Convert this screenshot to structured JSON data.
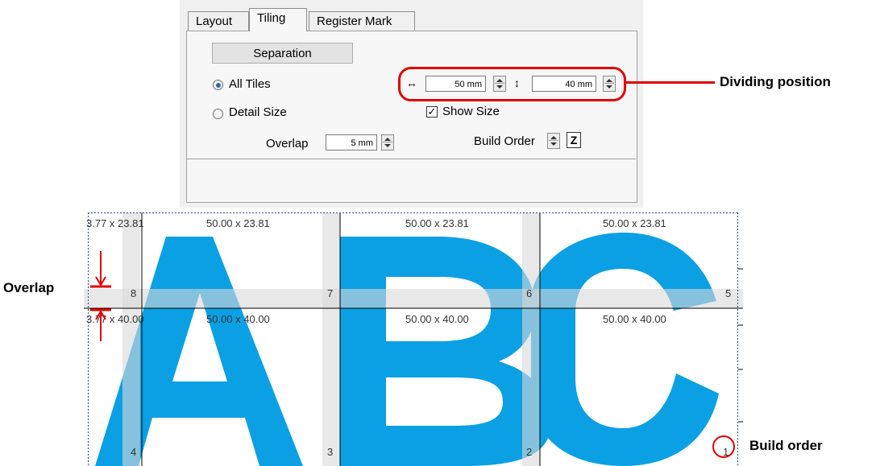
{
  "dialog": {
    "tabs": [
      {
        "label": "Layout"
      },
      {
        "label": "Tiling"
      },
      {
        "label": "Register Mark"
      }
    ],
    "separation_button": "Separation",
    "radio_all_tiles": "All Tiles",
    "radio_detail_size": "Detail Size",
    "overlap_label": "Overlap",
    "overlap_value": "5 mm",
    "width_value": "50 mm",
    "height_value": "40 mm",
    "show_size_label": "Show Size",
    "show_size_checked": true,
    "build_order_label": "Build Order",
    "selected_radio": "All Tiles"
  },
  "annotations": {
    "dividing_position": "Dividing position",
    "overlap": "Overlap",
    "build_order": "Build order",
    "build_order_number": "1",
    "color": "#e10000"
  },
  "preview": {
    "letters": "ABC",
    "letter_color": "#0ba0e4",
    "top_row_sizes": [
      "3.77 x 23.81",
      "50.00 x 23.81",
      "50.00 x 23.81",
      "50.00 x 23.81"
    ],
    "bottom_row_sizes": [
      "3.77 x 40.00",
      "50.00 x 40.00",
      "50.00 x 40.00",
      "50.00 x 40.00"
    ],
    "top_row_numbers": [
      "8",
      "7",
      "6",
      "5"
    ],
    "bottom_row_numbers": [
      "4",
      "3",
      "2",
      "1"
    ]
  }
}
